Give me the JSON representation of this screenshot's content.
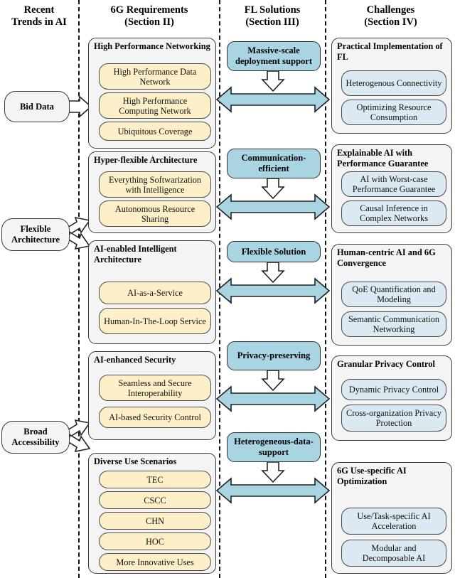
{
  "figure": {
    "columns": [
      {
        "id": "trends",
        "title_line1": "Recent",
        "title_line2": "Trends in AI"
      },
      {
        "id": "req",
        "title_line1": "6G Requirements",
        "title_line2": "(Section II)"
      },
      {
        "id": "fl",
        "title_line1": "FL Solutions",
        "title_line2": "(Section III)"
      },
      {
        "id": "chal",
        "title_line1": "Challenges",
        "title_line2": "(Section IV)"
      }
    ],
    "trends": [
      {
        "id": "bid-data",
        "line1": "Bid Data",
        "line2": ""
      },
      {
        "id": "flexible-architecture",
        "line1": "Flexible",
        "line2": "Architecture"
      },
      {
        "id": "broad-accessibility",
        "line1": "Broad",
        "line2": "Accessibility"
      }
    ],
    "requirements": [
      {
        "id": "high-performance-networking",
        "title": "High Performance Networking",
        "items": [
          "High Performance Data Network",
          "High Performance Computing Network",
          "Ubiquitous Coverage"
        ]
      },
      {
        "id": "hyper-flexible-architecture",
        "title": "Hyper-flexible Architecture",
        "items": [
          "Everything Softwarization with Intelligence",
          "Autonomous Resource Sharing"
        ]
      },
      {
        "id": "ai-enabled-intelligent-architecture",
        "title": "AI-enabled Intelligent Architecture",
        "items": [
          "AI-as-a-Service",
          "Human-In-The-Loop Service"
        ]
      },
      {
        "id": "ai-enhanced-security",
        "title": "AI-enhanced Security",
        "items": [
          "Seamless and Secure Interoperability",
          "AI-based Security Control"
        ]
      },
      {
        "id": "diverse-use-scenarios",
        "title": "Diverse Use Scenarios",
        "items": [
          "TEC",
          "CSCC",
          "CHN",
          "HOC",
          "More Innovative Uses"
        ]
      }
    ],
    "fl_solutions": [
      {
        "id": "massive-scale-deployment-support",
        "label": "Massive-scale deployment support"
      },
      {
        "id": "communication-efficient",
        "label": "Communication-efficient"
      },
      {
        "id": "flexible-solution",
        "label": "Flexible Solution"
      },
      {
        "id": "privacy-preserving",
        "label": "Privacy-preserving"
      },
      {
        "id": "heterogeneous-data-support",
        "label": "Heterogeneous-data-support"
      }
    ],
    "challenges": [
      {
        "id": "practical-implementation-of-fl",
        "title": "Practical Implementation of FL",
        "items": [
          "Heterogenous Connectivity",
          "Optimizing Resource Consumption"
        ]
      },
      {
        "id": "explainable-ai-with-performance-guarantee",
        "title": "Explainable AI with Performance Guarantee",
        "items": [
          "AI with Worst-case Performance Guarantee",
          "Causal Inference in Complex Networks"
        ]
      },
      {
        "id": "human-centric-ai-and-6g-convergence",
        "title": "Human-centric AI and 6G Convergence",
        "items": [
          "QoE Quantification and Modeling",
          "Semantic Communication Networking"
        ]
      },
      {
        "id": "granular-privacy-control",
        "title": "Granular Privacy Control",
        "items": [
          "Dynamic Privacy Control",
          "Cross-organization Privacy Protection"
        ]
      },
      {
        "id": "6g-use-specific-ai-optimization",
        "title": "6G Use-specific AI Optimization",
        "items": [
          "Use/Task-specific AI Acceleration",
          "Modular and Decomposable AI"
        ]
      }
    ],
    "colors": {
      "requirement_item_fill": "#fdf0c9",
      "challenge_item_fill": "#dbeaf2",
      "fl_solution_fill": "#a9d5e3",
      "group_fill": "#f4f4f4",
      "arrow_fill": "#a9d5e3",
      "outline": "#3a3a3a"
    }
  }
}
